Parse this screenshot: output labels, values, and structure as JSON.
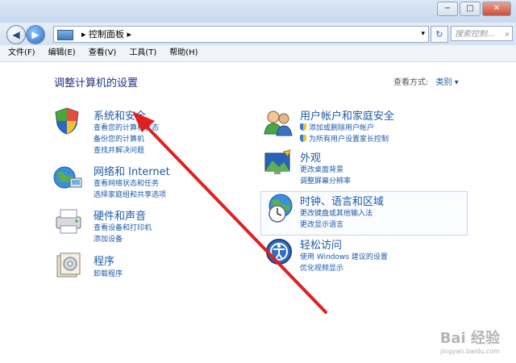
{
  "window": {
    "controls": [
      "−",
      "□",
      "✕"
    ]
  },
  "address": {
    "breadcrumb": "▸ 控制面板 ▸",
    "dropdown": "▾",
    "refresh": "↻",
    "search_placeholder": "搜索控制...",
    "search_icon": "search-icon"
  },
  "menu": [
    "文件(F)",
    "编辑(E)",
    "查看(V)",
    "工具(T)",
    "帮助(H)"
  ],
  "main": {
    "heading": "调整计算机的设置",
    "view_by_label": "查看方式:",
    "view_by_value": "类别 ▾"
  },
  "left_categories": [
    {
      "icon": "shield-icon",
      "title": "系统和安全",
      "links": [
        "查看您的计算机状态",
        "备份您的计算机",
        "查找并解决问题"
      ]
    },
    {
      "icon": "network-icon",
      "title": "网络和 Internet",
      "links": [
        "查看网络状态和任务",
        "选择家庭组和共享选项"
      ]
    },
    {
      "icon": "printer-icon",
      "title": "硬件和声音",
      "links": [
        "查看设备和打印机",
        "添加设备"
      ]
    },
    {
      "icon": "programs-icon",
      "title": "程序",
      "links": [
        "卸载程序"
      ]
    }
  ],
  "right_categories": [
    {
      "icon": "users-icon",
      "title": "用户帐户和家庭安全",
      "links": [
        "添加或删除用户帐户",
        "为所有用户设置家长控制"
      ]
    },
    {
      "icon": "appearance-icon",
      "title": "外观",
      "links": [
        "更改桌面背景",
        "调整屏幕分辨率"
      ]
    },
    {
      "icon": "clock-globe-icon",
      "title": "时钟、语言和区域",
      "links": [
        "更改键盘或其他输入法",
        "更改显示语言"
      ]
    },
    {
      "icon": "ease-of-access-icon",
      "title": "轻松访问",
      "links": [
        "使用 Windows 建议的设置",
        "优化视频显示"
      ]
    }
  ],
  "watermark": {
    "text": "Bai 经验",
    "sub": "jingyan.baidu.com"
  },
  "colors": {
    "link": "#1e5aa8",
    "heading": "#1e3287",
    "arrow": "#e02020"
  }
}
